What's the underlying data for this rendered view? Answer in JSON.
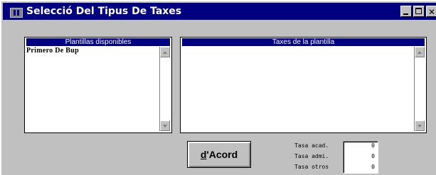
{
  "window": {
    "title": "Selecció Del Tipus De Taxes",
    "min_glyph": "",
    "max_glyph": "",
    "close_glyph": "✕"
  },
  "left_panel": {
    "header": "Plantillas disponibles",
    "items": [
      "Primero De Bup"
    ]
  },
  "right_panel": {
    "header": "Taxes de la plantilla",
    "items": []
  },
  "button": {
    "mnemonic": "d",
    "rest": "'Acord"
  },
  "totals": {
    "academic_label": "Tasa acad.",
    "academic_value": "0",
    "admin_label": "Tasa admi.",
    "admin_value": "0",
    "other_label": "Tasa otros",
    "other_value": "0"
  },
  "colors": {
    "face": "#c0c0c0",
    "titlebar": "#000080",
    "header": "#000080",
    "list_bg": "#ffffff"
  },
  "icons": {
    "app": "window-app-icon",
    "minimize": "minimize-icon",
    "maximize": "maximize-icon",
    "close": "close-icon",
    "scroll_up": "scroll-up-arrow-icon",
    "scroll_down": "scroll-down-arrow-icon"
  }
}
